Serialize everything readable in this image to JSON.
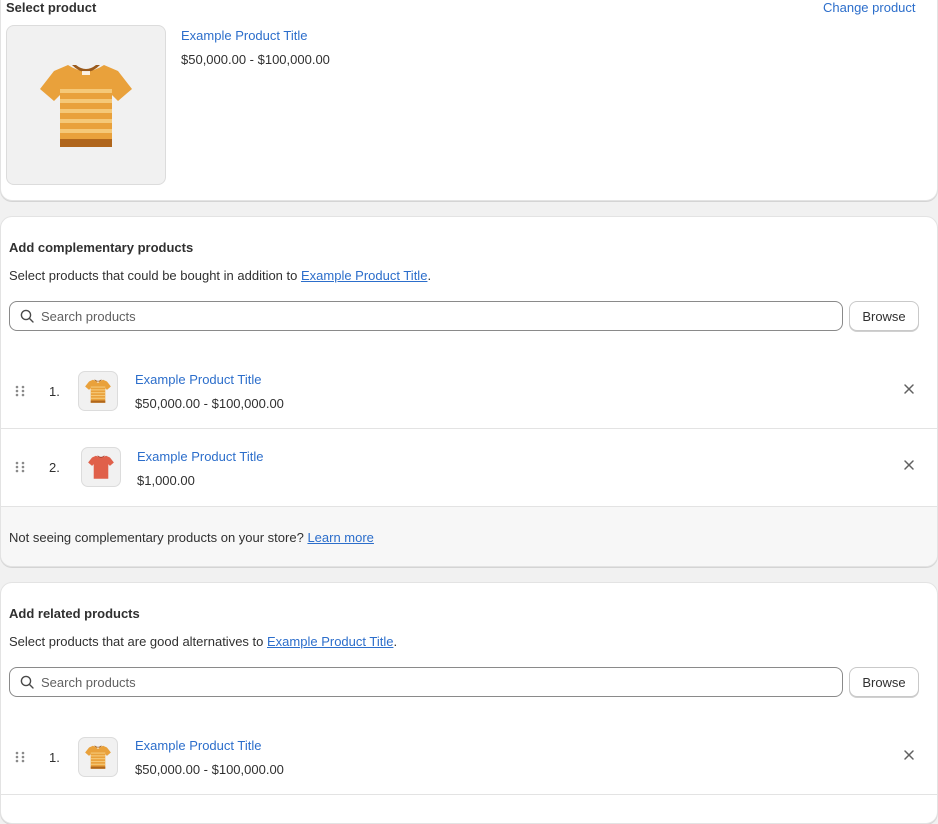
{
  "select_product": {
    "title": "Select product",
    "change_label": "Change product",
    "product": {
      "title": "Example Product Title",
      "price": "$50,000.00 - $100,000.00"
    }
  },
  "complementary": {
    "title": "Add complementary products",
    "desc_prefix": "Select products that could be bought in addition to ",
    "desc_link": "Example Product Title",
    "desc_suffix": ".",
    "search_placeholder": "Search products",
    "browse_label": "Browse",
    "items": [
      {
        "index": "1.",
        "title": "Example Product Title",
        "price": "$50,000.00 - $100,000.00",
        "icon": "orange-striped-tshirt-icon"
      },
      {
        "index": "2.",
        "title": "Example Product Title",
        "price": "$1,000.00",
        "icon": "red-tshirt-icon"
      }
    ],
    "footer_text": "Not seeing complementary products on your store? ",
    "footer_link": "Learn more"
  },
  "related": {
    "title": "Add related products",
    "desc_prefix": "Select products that are good alternatives to ",
    "desc_link": "Example Product Title",
    "desc_suffix": ".",
    "search_placeholder": "Search products",
    "browse_label": "Browse",
    "items": [
      {
        "index": "1.",
        "title": "Example Product Title",
        "price": "$50,000.00 - $100,000.00",
        "icon": "orange-striped-tshirt-icon"
      }
    ]
  },
  "colors": {
    "link": "#2c6ecb",
    "tshirt_orange": "#e9a13b",
    "tshirt_stripe": "#f5c877",
    "tshirt_red": "#e0604a"
  }
}
